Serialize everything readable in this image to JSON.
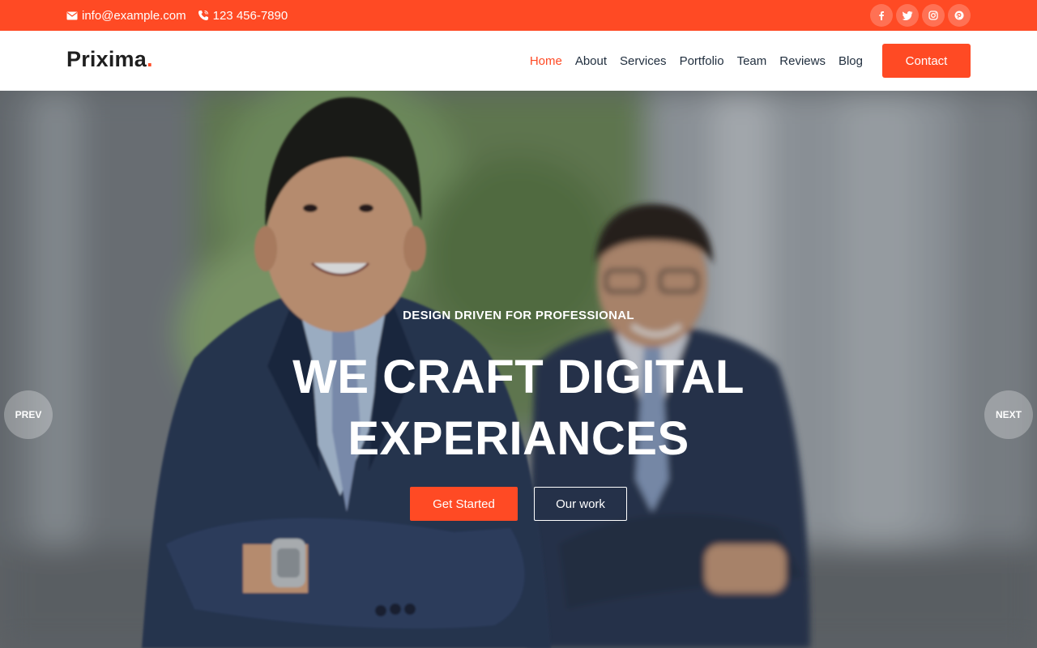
{
  "topbar": {
    "email": "info@example.com",
    "phone": "123 456-7890",
    "social": [
      "facebook-icon",
      "twitter-icon",
      "instagram-icon",
      "pinterest-icon"
    ]
  },
  "header": {
    "logo_text": "Prixima",
    "logo_dot": ".",
    "nav": [
      {
        "label": "Home",
        "active": true
      },
      {
        "label": "About"
      },
      {
        "label": "Services"
      },
      {
        "label": "Portfolio"
      },
      {
        "label": "Team"
      },
      {
        "label": "Reviews"
      },
      {
        "label": "Blog"
      }
    ],
    "contact_label": "Contact"
  },
  "hero": {
    "kicker": "DESIGN DRIVEN FOR PROFESSIONAL",
    "headline_line1": "WE CRAFT DIGITAL",
    "headline_line2": "EXPERIANCES",
    "primary_label": "Get Started",
    "secondary_label": "Our work",
    "prev_label": "PREV",
    "next_label": "NEXT"
  },
  "colors": {
    "accent": "#ff4a24",
    "text_dark": "#1f2d3d"
  }
}
